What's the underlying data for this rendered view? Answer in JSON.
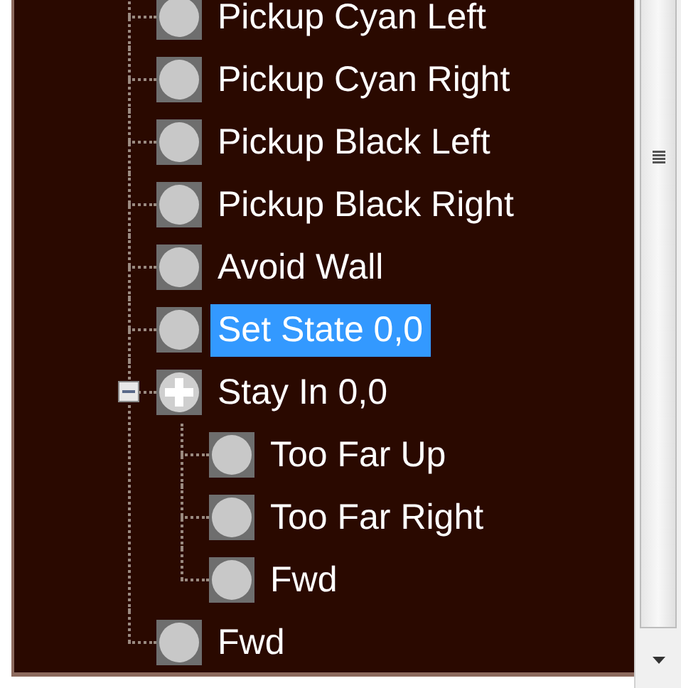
{
  "tree": {
    "items": [
      {
        "label": "Pickup Cyan Left",
        "selected": false
      },
      {
        "label": "Pickup Cyan Right",
        "selected": false
      },
      {
        "label": "Pickup Black Left",
        "selected": false
      },
      {
        "label": "Pickup Black Right",
        "selected": false
      },
      {
        "label": "Avoid Wall",
        "selected": false
      },
      {
        "label": "Set State 0,0",
        "selected": true
      },
      {
        "label": "Stay In 0,0",
        "selected": false,
        "expanded": true,
        "children": [
          {
            "label": "Too Far Up",
            "selected": false
          },
          {
            "label": "Too Far Right",
            "selected": false
          },
          {
            "label": "Fwd",
            "selected": false
          }
        ]
      },
      {
        "label": "Fwd",
        "selected": false
      }
    ]
  }
}
